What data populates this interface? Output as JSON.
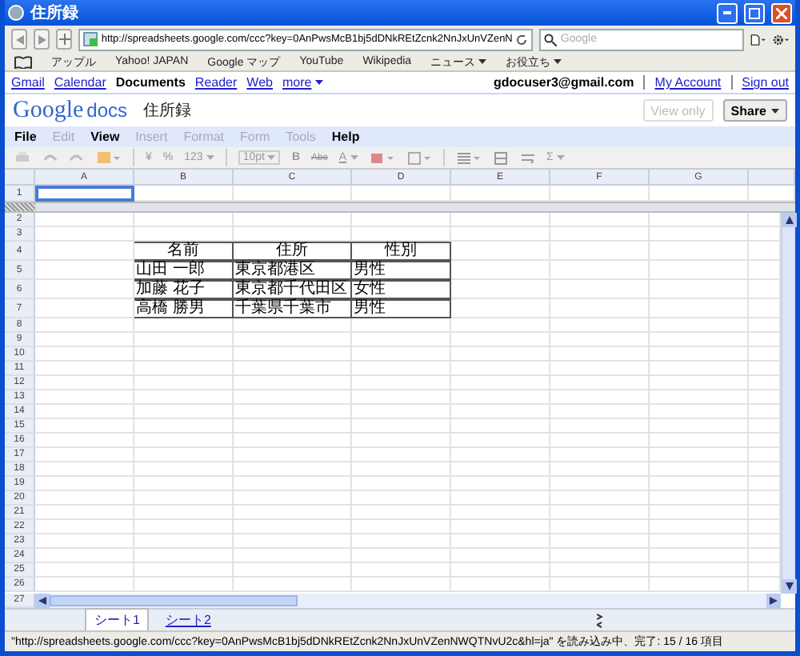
{
  "window": {
    "title": "住所録"
  },
  "browser": {
    "url": "http://spreadsheets.google.com/ccc?key=0AnPwsMcB1bj5dDNkREtZcnk2NnJxUnVZenN",
    "search": {
      "placeholder": "Google"
    }
  },
  "bookmarks": [
    {
      "label": "アップル",
      "menu": false
    },
    {
      "label": "Yahoo! JAPAN",
      "menu": false
    },
    {
      "label": "Google マップ",
      "menu": false
    },
    {
      "label": "YouTube",
      "menu": false
    },
    {
      "label": "Wikipedia",
      "menu": false
    },
    {
      "label": "ニュース",
      "menu": true
    },
    {
      "label": "お役立ち",
      "menu": true
    }
  ],
  "google_bar": {
    "links": [
      {
        "label": "Gmail",
        "selected": false,
        "menu": false
      },
      {
        "label": "Calendar",
        "selected": false,
        "menu": false
      },
      {
        "label": "Documents",
        "selected": true,
        "menu": false
      },
      {
        "label": "Reader",
        "selected": false,
        "menu": false
      },
      {
        "label": "Web",
        "selected": false,
        "menu": false
      },
      {
        "label": "more",
        "selected": false,
        "menu": true
      }
    ],
    "user": "gdocuser3@gmail.com",
    "account_links": [
      "My Account",
      "Sign out"
    ]
  },
  "doc": {
    "logo_google": "Google",
    "logo_docs": "docs",
    "title": "住所録",
    "buttons": [
      {
        "label": "View only",
        "disabled": true,
        "menu": false
      },
      {
        "label": "Share",
        "disabled": false,
        "menu": true
      }
    ]
  },
  "menu": [
    {
      "label": "File",
      "disabled": false
    },
    {
      "label": "Edit",
      "disabled": true
    },
    {
      "label": "View",
      "disabled": false
    },
    {
      "label": "Insert",
      "disabled": true
    },
    {
      "label": "Format",
      "disabled": true
    },
    {
      "label": "Form",
      "disabled": true
    },
    {
      "label": "Tools",
      "disabled": true
    },
    {
      "label": "Help",
      "disabled": false
    }
  ],
  "toolbar": {
    "currency": "¥",
    "percent": "%",
    "number_format": "123",
    "font_size": "10pt",
    "bold": "B",
    "strike": "Abc",
    "text_color": "A",
    "sum": "Σ"
  },
  "columns": [
    "A",
    "B",
    "C",
    "D",
    "E",
    "F",
    "G"
  ],
  "frozen_rows": [
    {
      "number": "1",
      "selected": true
    }
  ],
  "rows": [
    {
      "number": "2"
    },
    {
      "number": "3"
    },
    {
      "number": "4",
      "table": [
        "名前",
        "住所",
        "性別"
      ],
      "header": true
    },
    {
      "number": "5",
      "table": [
        "山田 一郎",
        "東京都港区",
        "男性"
      ],
      "header": false
    },
    {
      "number": "6",
      "table": [
        "加藤 花子",
        "東京都千代田区",
        "女性"
      ],
      "header": false
    },
    {
      "number": "7",
      "table": [
        "高橋 勝男",
        "千葉県千葉市",
        "男性"
      ],
      "header": false
    },
    {
      "number": "8"
    },
    {
      "number": "9"
    },
    {
      "number": "10"
    },
    {
      "number": "11"
    },
    {
      "number": "12"
    },
    {
      "number": "13"
    },
    {
      "number": "14"
    },
    {
      "number": "15"
    },
    {
      "number": "16"
    },
    {
      "number": "17"
    },
    {
      "number": "18"
    },
    {
      "number": "19"
    },
    {
      "number": "20"
    },
    {
      "number": "21"
    },
    {
      "number": "22"
    },
    {
      "number": "23"
    },
    {
      "number": "24"
    },
    {
      "number": "25"
    },
    {
      "number": "26"
    }
  ],
  "last_row": {
    "number": "27"
  },
  "sheets": [
    {
      "label": "シート1",
      "selected": true
    },
    {
      "label": "シート2",
      "selected": false
    }
  ],
  "status_bar": "\"http://spreadsheets.google.com/ccc?key=0AnPwsMcB1bj5dDNkREtZcnk2NnJxUnVZenNWQTNvU2c&hl=ja\" を読み込み中、完了: 15 / 16 項目"
}
